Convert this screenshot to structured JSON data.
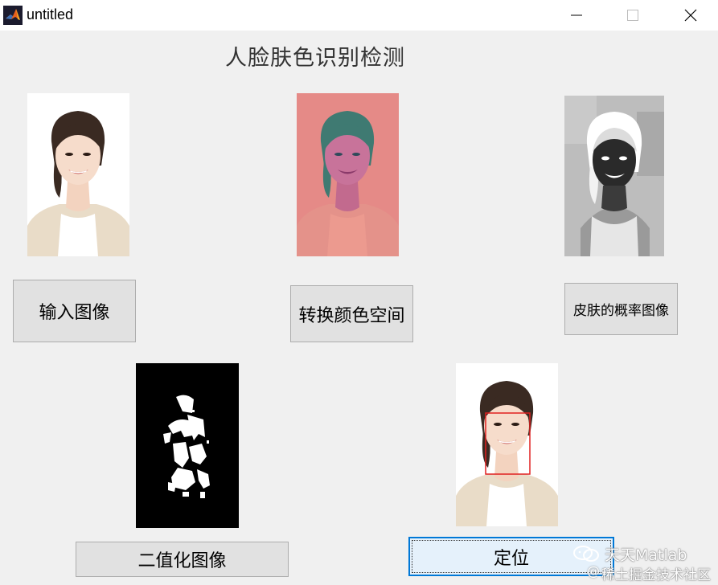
{
  "window": {
    "title": "untitled",
    "controls": [
      "minimize-icon",
      "maximize-icon",
      "close-icon"
    ]
  },
  "heading": "人脸肤色识别检测",
  "buttons": {
    "input_image": "输入图像",
    "convert_color_space": "转换颜色空间",
    "skin_probability": "皮肤的概率图像",
    "binarize": "二值化图像",
    "locate": "定位"
  },
  "images": {
    "input": "portrait-photo",
    "converted": "ycbcr-tinted-portrait",
    "probability": "grayscale-skin-probability-map",
    "binary": "black-white-binary-mask",
    "located": "portrait-with-face-bounding-box"
  },
  "watermark": {
    "line1": "天天Matlab",
    "line2": "稀土掘金技术社区"
  },
  "colors": {
    "face_box": "#e02020",
    "focus_border": "#0078d7"
  }
}
